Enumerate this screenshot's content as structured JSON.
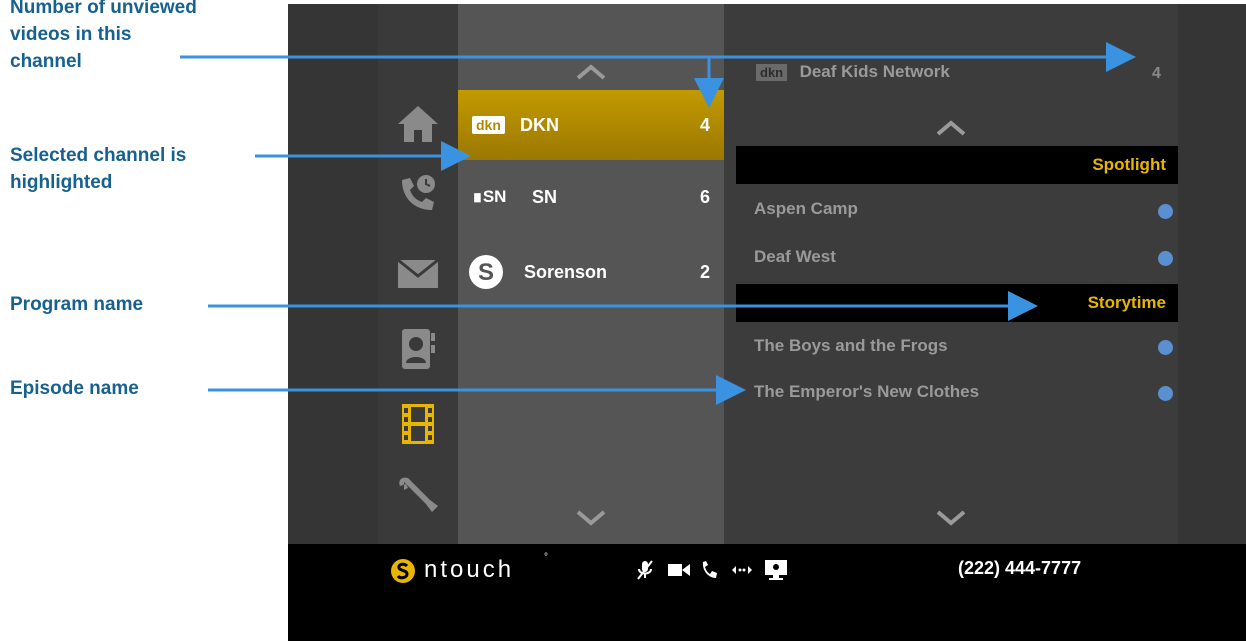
{
  "annotations": {
    "unviewed_line1": "Number of unviewed",
    "unviewed_line2": "videos in this",
    "unviewed_line3": "channel",
    "selected_line1": "Selected channel is",
    "selected_line2": "highlighted",
    "program": "Program name",
    "episode": "Episode name"
  },
  "nav": {
    "icons": [
      "home-icon",
      "call-history-icon",
      "mail-icon",
      "contacts-icon",
      "video-center-icon",
      "settings-icon"
    ],
    "active": "video-center-icon",
    "active_color": "#e8b600"
  },
  "channels": {
    "items": [
      {
        "logo": "dkn",
        "name": "DKN",
        "count": "4",
        "selected": true
      },
      {
        "logo": "SN",
        "name": "SN",
        "count": "6",
        "selected": false
      },
      {
        "logo": "S",
        "name": "Sorenson",
        "count": "2",
        "selected": false
      }
    ]
  },
  "videos": {
    "channel_logo": "dkn",
    "channel_title": "Deaf Kids Network",
    "channel_count": "4",
    "programs": [
      {
        "name": "Spotlight",
        "episodes": [
          "Aspen Camp",
          "Deaf West"
        ]
      },
      {
        "name": "Storytime",
        "episodes": [
          "The Boys and the Frogs",
          "The Emperor's New Clothes"
        ]
      }
    ],
    "unviewed_dot_color": "#5a8fd0"
  },
  "statusbar": {
    "brand": "ntouch",
    "phone": "(222) 444-7777",
    "icons": [
      "mute-icon",
      "video-icon",
      "phone-icon",
      "transfer-icon",
      "screen-share-icon"
    ]
  },
  "colors": {
    "annotation": "#17618f",
    "arrow": "#3a92e0",
    "highlight": "#c39a00"
  }
}
